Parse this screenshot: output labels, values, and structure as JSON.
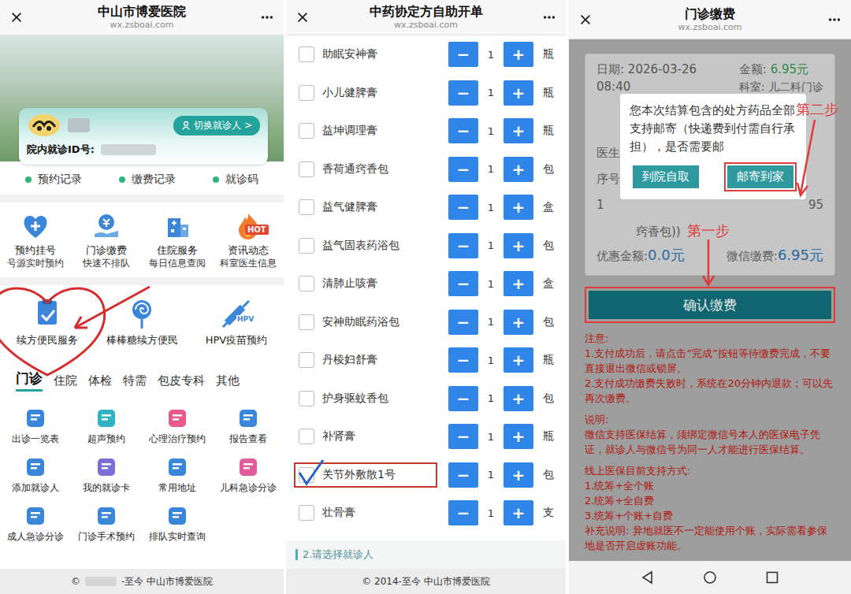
{
  "home": {
    "window": {
      "title": "中山市博爱医院",
      "url": "wx.zsboai.com"
    },
    "patient": {
      "id_label": "院内就诊ID号:",
      "switch_button": "切换就诊人 >"
    },
    "quick_links": [
      "预约记录",
      "缴费记录",
      "就诊码"
    ],
    "services": [
      {
        "title": "预约挂号",
        "subtitle": "号源实时预约"
      },
      {
        "title": "门诊缴费",
        "subtitle": "快速不排队"
      },
      {
        "title": "住院服务",
        "subtitle": "每日信息查阅"
      },
      {
        "title": "资讯动态",
        "subtitle": "科室医生信息",
        "badge": "HOT"
      }
    ],
    "services2": [
      {
        "label": "续方便民服务",
        "highlighted": true
      },
      {
        "label": "棒棒糖续方便民",
        "highlighted": false
      },
      {
        "label": "HPV疫苗预约",
        "highlighted": false,
        "badge": "HPV"
      }
    ],
    "tabs": [
      {
        "label": "门诊",
        "selected": true
      },
      {
        "label": "住院",
        "selected": false
      },
      {
        "label": "体检",
        "selected": false
      },
      {
        "label": "特需",
        "selected": false
      },
      {
        "label": "包皮专科",
        "selected": false
      },
      {
        "label": "其他",
        "selected": false
      }
    ],
    "functions": [
      "出诊一览表",
      "超声预约",
      "心理治疗预约",
      "报告查看",
      "添加就诊人",
      "我的就诊卡",
      "常用地址",
      "儿科急诊分诊",
      "成人急诊分诊",
      "门诊手术预约",
      "排队实时查询"
    ],
    "footer": {
      "symbol": "©",
      "text": "-至今 中山市博爱医院"
    }
  },
  "order": {
    "window": {
      "title": "中药协定方自助开单",
      "url": "wx.zsboai.com"
    },
    "minus": "−",
    "plus": "+",
    "items": [
      {
        "name": "助眠安神膏",
        "qty": "1",
        "unit": "瓶",
        "checked": false
      },
      {
        "name": "小儿健脾膏",
        "qty": "1",
        "unit": "瓶",
        "checked": false
      },
      {
        "name": "益坤调理膏",
        "qty": "1",
        "unit": "瓶",
        "checked": false
      },
      {
        "name": "香荷通窍香包",
        "qty": "1",
        "unit": "包",
        "checked": false
      },
      {
        "name": "益气健脾膏",
        "qty": "1",
        "unit": "盒",
        "checked": false
      },
      {
        "name": "益气固表药浴包",
        "qty": "1",
        "unit": "包",
        "checked": false
      },
      {
        "name": "清肺止咳膏",
        "qty": "1",
        "unit": "盒",
        "checked": false
      },
      {
        "name": "安神助眠药浴包",
        "qty": "1",
        "unit": "包",
        "checked": false
      },
      {
        "name": "丹棱妇舒膏",
        "qty": "1",
        "unit": "瓶",
        "checked": false
      },
      {
        "name": "护身驱蚊香包",
        "qty": "1",
        "unit": "包",
        "checked": false
      },
      {
        "name": "补肾膏",
        "qty": "1",
        "unit": "瓶",
        "checked": false
      },
      {
        "name": "关节外敷散1号",
        "qty": "1",
        "unit": "包",
        "checked": true
      },
      {
        "name": "壮骨膏",
        "qty": "1",
        "unit": "支",
        "checked": false
      }
    ],
    "section": "2.请选择就诊人",
    "footer": "© 2014-至今 中山市博爱医院"
  },
  "payment": {
    "window": {
      "title": "门诊缴费",
      "url": "wx.zsboai.com"
    },
    "bill": {
      "date_label": "日期:",
      "date": "2026-03-26 08:40",
      "amount_label": "金额:",
      "amount": "6.95元",
      "dept": "科室: 儿二科门诊",
      "doctor_label": "医生",
      "index_label": "序号",
      "row_index": "1",
      "row_price": "95",
      "row_item": "窍香包))",
      "discount_label": "优惠金额:",
      "discount": "0.0元",
      "wechat_label": "微信缴费:",
      "wechat": "6.95元"
    },
    "dialog": {
      "message": "您本次结算包含的处方药品全部支持邮寄（快递费到付需自行承担），是否需要邮",
      "buttons": [
        {
          "label": "到院自取",
          "highlighted": false
        },
        {
          "label": "邮寄到家",
          "highlighted": true
        }
      ]
    },
    "confirm_button": {
      "label": "确认缴费",
      "highlighted": true
    },
    "annotations": {
      "step1": "第一步",
      "step2": "第二步"
    },
    "notes": [
      {
        "text": "注意:",
        "kind": "heading"
      },
      {
        "text": "1.支付成功后，请点击“完成”按钮等待缴费完成，不要直接退出微信或锁屏。",
        "kind": "line"
      },
      {
        "text": "2.支付成功缴费失败时，系统在20分钟内退款；可以先再次缴费。",
        "kind": "line"
      },
      {
        "text": "说明:",
        "kind": "heading"
      },
      {
        "text": "微信支持医保结算，须绑定微信号本人的医保电子凭证，就诊人与微信号为同一人才能进行医保结算。",
        "kind": "line"
      },
      {
        "text": "线上医保目前支持方式:",
        "kind": "heading"
      },
      {
        "text": "1.统筹+全个账",
        "kind": "line"
      },
      {
        "text": "2.统筹+全自费",
        "kind": "line"
      },
      {
        "text": "3.统筹+个账+自费",
        "kind": "line"
      },
      {
        "text": "补充说明: 异地就医不一定能使用个账，实际需看参保地是否开启虚账功能。",
        "kind": "line"
      }
    ]
  }
}
